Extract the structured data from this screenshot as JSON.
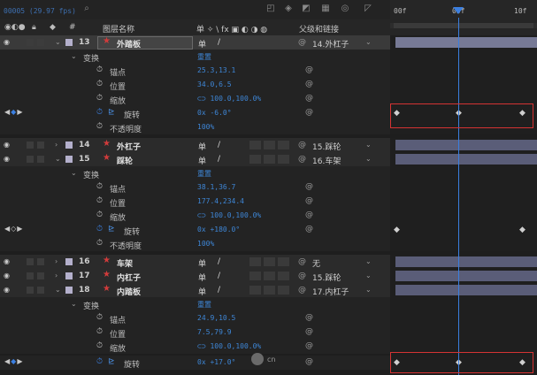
{
  "app": {
    "timecode": "00005 (29.97 fps)",
    "search_icon": "search-icon"
  },
  "ruler": {
    "labels": [
      "00f",
      "05f",
      "10f"
    ]
  },
  "header": {
    "label_col": "#",
    "name_col": "图层名称",
    "switches": "单 ✧ \\ fx ▣ ◐ ◑ ◍",
    "parent_col": "父级和链接"
  },
  "layers": [
    {
      "num": "13",
      "name": "外踏板",
      "parent": "14.外杠子"
    },
    {
      "num": "14",
      "name": "外杠子",
      "parent": "15.踩轮"
    },
    {
      "num": "15",
      "name": "踩轮",
      "parent": "16.车架"
    },
    {
      "num": "16",
      "name": "车架",
      "parent": "无"
    },
    {
      "num": "17",
      "name": "内杠子",
      "parent": "15.踩轮"
    },
    {
      "num": "18",
      "name": "内踏板",
      "parent": "17.内杠子"
    }
  ],
  "props": {
    "transform": "变换",
    "reset": "重置",
    "anchor": "锚点",
    "position": "位置",
    "scale": "缩放",
    "rotation": "旋转",
    "opacity": "不透明度"
  },
  "values": {
    "l13": {
      "anchor": "25.3,13.1",
      "position": "34.0,6.5",
      "scale": "100.0,100.0%",
      "rotation": "0x -6.0°",
      "opacity": "100%"
    },
    "l15": {
      "anchor": "38.1,36.7",
      "position": "177.4,234.4",
      "scale": "100.0,100.0%",
      "rotation": "0x +180.0°",
      "opacity": "100%"
    },
    "l18": {
      "anchor": "24.9,10.5",
      "position": "7.5,79.9",
      "scale": "100.0,100.0%",
      "rotation": "0x +17.0°"
    }
  },
  "watermark": "cn",
  "colors": {
    "accent": "#3b7fe0",
    "keyframe_highlight": "#d43333",
    "layer_label": "#b4b0cc",
    "layer_icon": "#d23b3b"
  }
}
